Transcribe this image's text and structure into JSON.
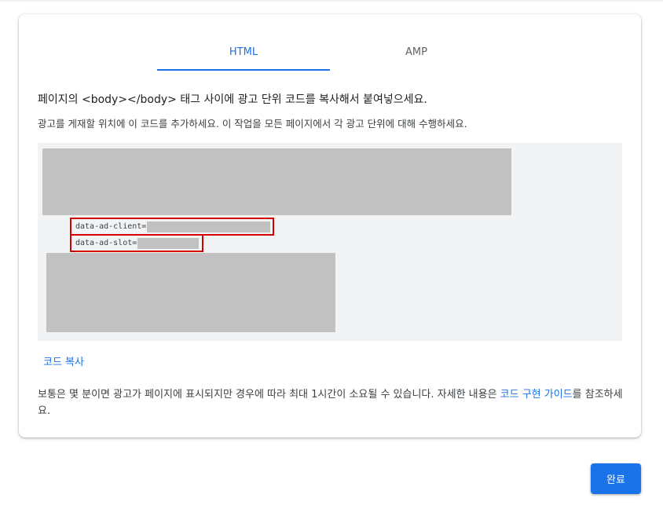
{
  "tabs": [
    {
      "label": "HTML",
      "active": true
    },
    {
      "label": "AMP",
      "active": false
    }
  ],
  "heading": "페이지의 <body></body> 태그 사이에 광고 단위 코드를 복사해서 붙여넣으세요.",
  "subtext": "광고를 게재할 위치에 이 코드를 추가하세요. 이 작업을 모든 페이지에서 각 광고 단위에 대해 수행하세요.",
  "code": {
    "client_attr": "data-ad-client=",
    "slot_attr": "data-ad-slot="
  },
  "copy_link": "코드 복사",
  "footnote": {
    "text_before": "보통은 몇 분이면 광고가 페이지에 표시되지만 경우에 따라 최대 1시간이 소요될 수 있습니다. 자세한 내용은 ",
    "link": "코드 구현 가이드",
    "text_after": "를 참조하세요."
  },
  "done_button": "완료",
  "colors": {
    "accent": "#1a73e8",
    "highlight_border": "#d50000",
    "redaction": "#c1c1c1",
    "code_background": "#f1f3f4"
  }
}
